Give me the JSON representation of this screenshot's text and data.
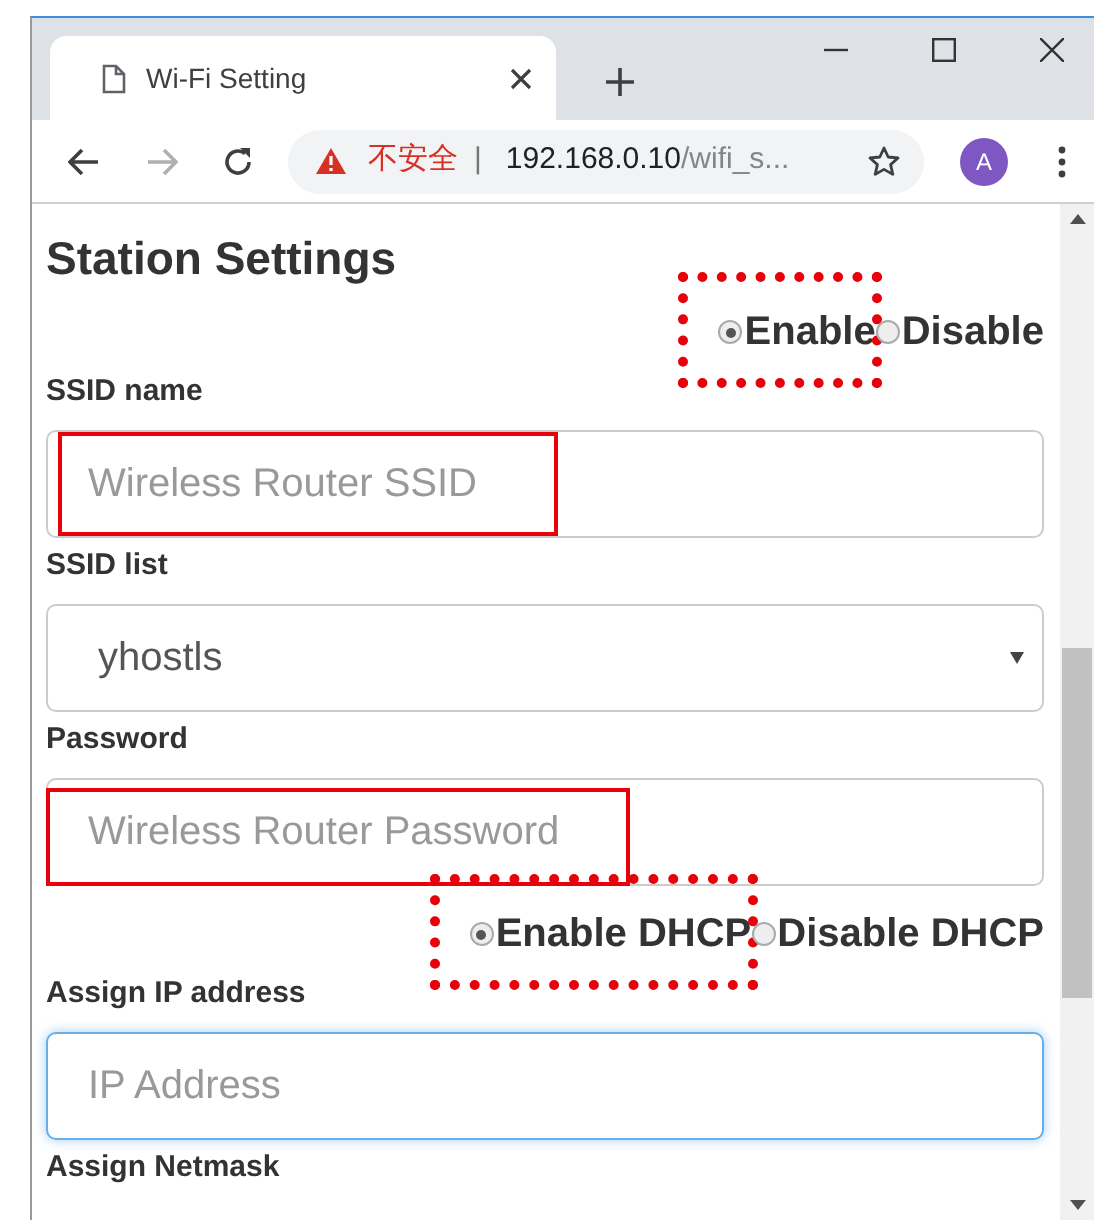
{
  "browser": {
    "tab": {
      "title": "Wi-Fi Setting"
    },
    "address": {
      "warning": "不安全",
      "separator": "|",
      "host": "192.168.0.10",
      "path": "/wifi_s..."
    },
    "avatar": "A"
  },
  "page": {
    "heading": "Station Settings",
    "items": [
      {
        "kind": "radios",
        "options": [
          {
            "label": "Enable",
            "selected": true,
            "highlighted": true
          },
          {
            "label": "Disable",
            "selected": false,
            "highlighted": false
          }
        ]
      },
      {
        "kind": "label",
        "text": "SSID name"
      },
      {
        "kind": "input",
        "placeholder": "Wireless Router SSID",
        "highlighted": true,
        "focused": false
      },
      {
        "kind": "label",
        "text": "SSID list"
      },
      {
        "kind": "select",
        "value": "yhostls"
      },
      {
        "kind": "label",
        "text": "Password"
      },
      {
        "kind": "input",
        "placeholder": "Wireless Router Password",
        "highlighted": true,
        "focused": false
      },
      {
        "kind": "radios",
        "options": [
          {
            "label": "Enable DHCP",
            "selected": true,
            "highlighted": true
          },
          {
            "label": "Disable DHCP",
            "selected": false,
            "highlighted": false
          }
        ]
      },
      {
        "kind": "label",
        "text": "Assign IP address"
      },
      {
        "kind": "input",
        "placeholder": "IP Address",
        "highlighted": false,
        "focused": true
      },
      {
        "kind": "label",
        "text": "Assign Netmask"
      }
    ]
  }
}
